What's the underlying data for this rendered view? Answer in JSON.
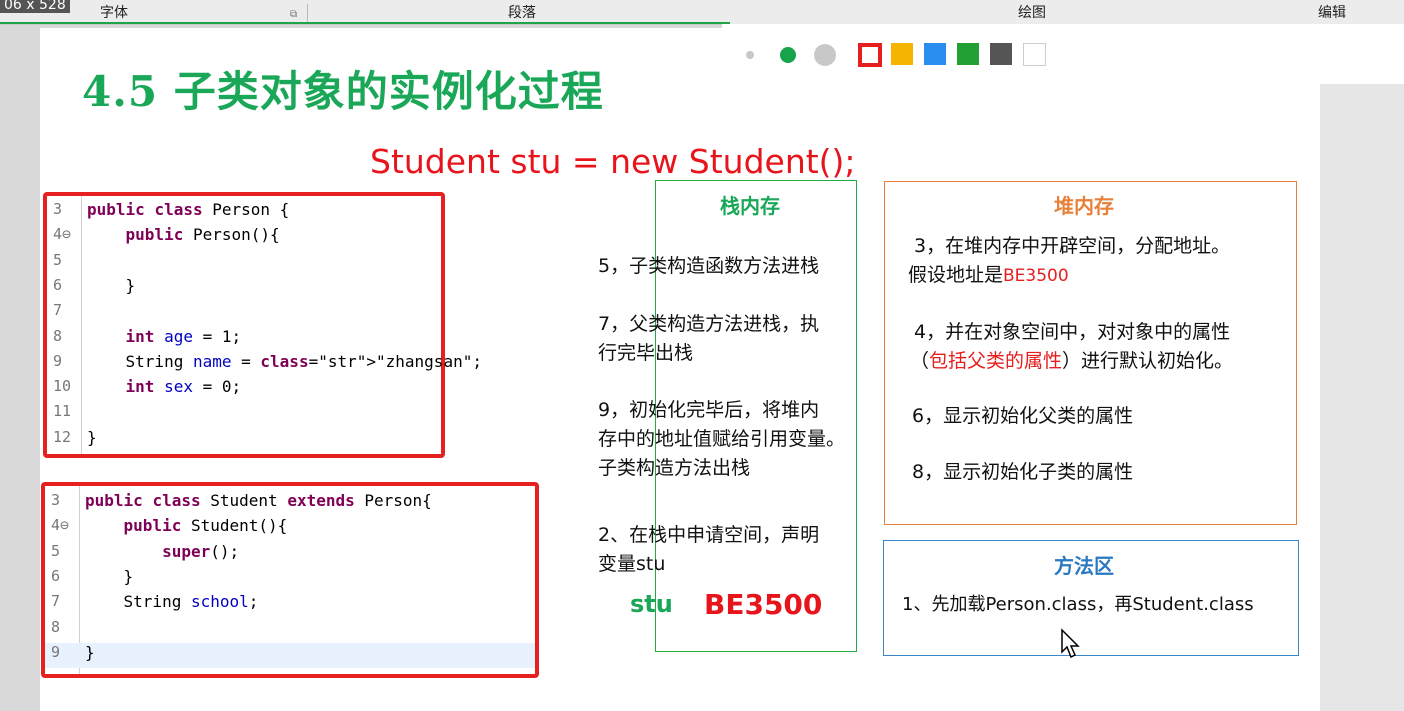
{
  "ribbon": {
    "size_text": "06 x 528",
    "font_group": "字体",
    "paragraph_group": "段落",
    "drawing_group": "绘图",
    "edit_group": "编辑"
  },
  "pen_toolbar": {
    "dots": [
      "small-gray",
      "green",
      "gray"
    ],
    "swatches": [
      "#e61e1e",
      "#f5b400",
      "#2a8ef0",
      "#22a033",
      "#555555",
      "#ffffff"
    ]
  },
  "slide": {
    "title": "4.5  子类对象的实例化过程",
    "statement": "Student stu = new Student();",
    "colors": {
      "title": "#1aa858",
      "statement": "#e8141c"
    },
    "code_person": [
      {
        "n": "3",
        "t": "public class Person {"
      },
      {
        "n": "4⊖",
        "t": "    public Person(){"
      },
      {
        "n": "5",
        "t": ""
      },
      {
        "n": "6",
        "t": "    }"
      },
      {
        "n": "7",
        "t": ""
      },
      {
        "n": "8",
        "t": "    int age = 1;"
      },
      {
        "n": "9",
        "t": "    String name = \"zhangsan\";"
      },
      {
        "n": "10",
        "t": "    int sex = 0;"
      },
      {
        "n": "11",
        "t": ""
      },
      {
        "n": "12",
        "t": "}"
      }
    ],
    "code_student": [
      {
        "n": "3",
        "t": "public class Student extends Person{"
      },
      {
        "n": "4⊖",
        "t": "    public Student(){"
      },
      {
        "n": "5",
        "t": "        super();"
      },
      {
        "n": "6",
        "t": "    }"
      },
      {
        "n": "7",
        "t": "    String school;"
      },
      {
        "n": "8",
        "t": ""
      },
      {
        "n": "9",
        "t": "}"
      }
    ],
    "stack": {
      "title": "栈内存",
      "notes": [
        "5，子类构造函数方法进栈",
        "7，父类构造方法进栈，执\n行完毕出栈",
        "9，初始化完毕后，将堆内\n存中的地址值赋给引用变量。\n子类构造方法出栈",
        "2、在栈中申请空间，声明\n变量stu"
      ],
      "var_name": "stu",
      "var_value": "BE3500"
    },
    "heap": {
      "title": "堆内存",
      "note3_a": "3，在堆内存中开辟空间，分配地址。",
      "note3_b": "假设地址是",
      "note3_addr": "BE3500",
      "note4_a": "4，并在对象空间中，对对象中的属性",
      "note4_b1": "（",
      "note4_red": "包括父类的属性",
      "note4_b2": "）进行默认初始化。",
      "note6": "6，显示初始化父类的属性",
      "note8": "8，显示初始化子类的属性"
    },
    "method_area": {
      "title": "方法区",
      "note1": "1、先加载Person.class，再Student.class"
    }
  }
}
